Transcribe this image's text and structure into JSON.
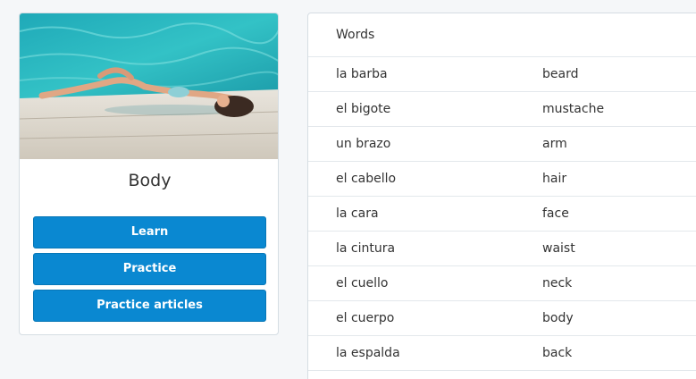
{
  "card": {
    "image_name": "pool-photo",
    "title": "Body",
    "buttons": {
      "learn": "Learn",
      "practice": "Practice",
      "practice_articles": "Practice articles"
    },
    "button_color": "#0a88d1"
  },
  "words": {
    "header": "Words",
    "rows": [
      {
        "es": "la barba",
        "en": "beard"
      },
      {
        "es": "el bigote",
        "en": "mustache"
      },
      {
        "es": "un brazo",
        "en": "arm"
      },
      {
        "es": "el cabello",
        "en": "hair"
      },
      {
        "es": "la cara",
        "en": "face"
      },
      {
        "es": "la cintura",
        "en": "waist"
      },
      {
        "es": "el cuello",
        "en": "neck"
      },
      {
        "es": "el cuerpo",
        "en": "body"
      },
      {
        "es": "la espalda",
        "en": "back"
      }
    ]
  }
}
